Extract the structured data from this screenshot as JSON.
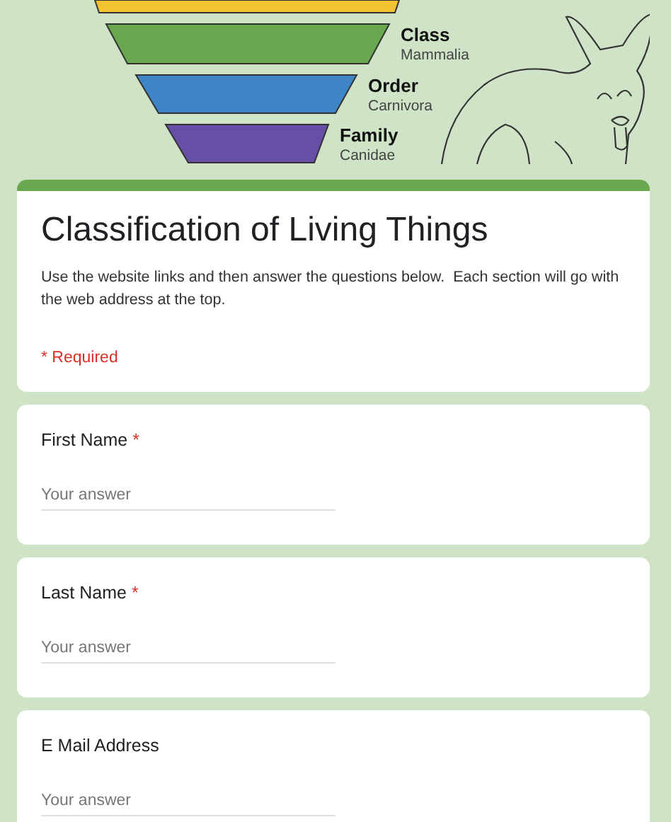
{
  "banner": {
    "levels": [
      {
        "color": "#f1c232"
      },
      {
        "rank": "Class",
        "name": "Mammalia",
        "color": "#6aa84f"
      },
      {
        "rank": "Order",
        "name": "Carnivora",
        "color": "#3d85c6"
      },
      {
        "rank": "Family",
        "name": "Canidae",
        "color": "#674ea7"
      }
    ]
  },
  "header": {
    "title": "Classification of Living Things",
    "description": "Use the website links and then answer the questions below.  Each section will go with the web address at the top.",
    "required_note": "* Required"
  },
  "questions": [
    {
      "label": "First Name",
      "required_mark": "*",
      "placeholder": "Your answer"
    },
    {
      "label": "Last Name",
      "required_mark": "*",
      "placeholder": "Your answer"
    },
    {
      "label": "E Mail Address",
      "placeholder": "Your answer"
    }
  ]
}
